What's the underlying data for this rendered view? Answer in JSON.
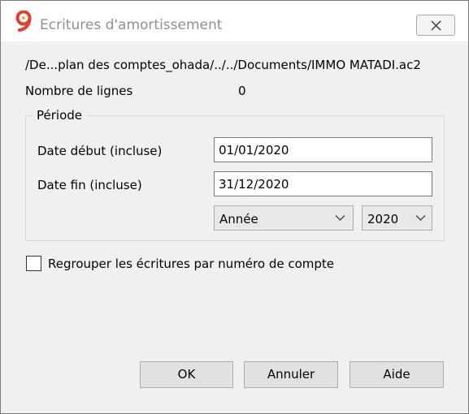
{
  "window": {
    "title": "Ecritures d'amortissement"
  },
  "file_path": "/De...plan des comptes_ohada/../../Documents/IMMO MATADI.ac2",
  "line_count": {
    "label": "Nombre de lignes",
    "value": "0"
  },
  "period": {
    "title": "Période",
    "start_label": "Date début (incluse)",
    "start_value": "01/01/2020",
    "end_label": "Date fin (incluse)",
    "end_value": "31/12/2020",
    "period_type": "Année",
    "year": "2020"
  },
  "group_checkbox": {
    "label": "Regrouper les écritures par numéro de compte",
    "checked": false
  },
  "buttons": {
    "ok": "OK",
    "cancel": "Annuler",
    "help": "Aide"
  }
}
